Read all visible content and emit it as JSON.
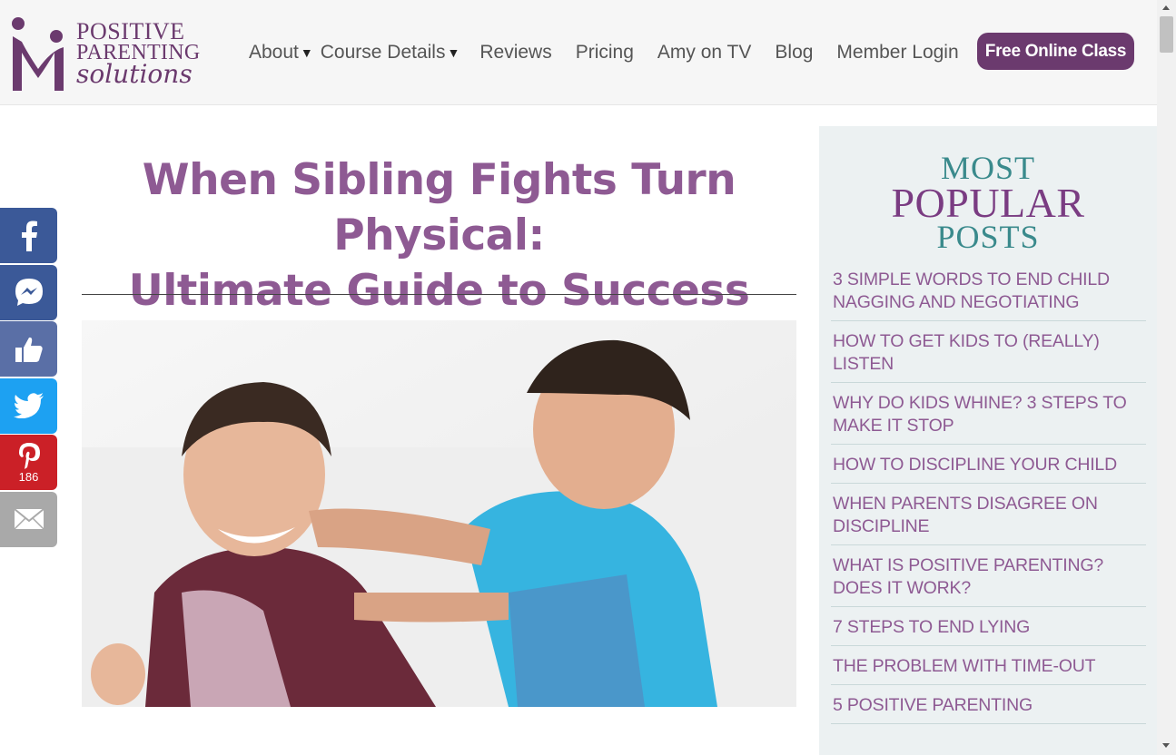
{
  "brand": {
    "line1": "POSITIVE",
    "line2": "PARENTING",
    "line3": "solutions",
    "color": "#6b3a6e"
  },
  "nav": {
    "items": [
      {
        "label": "About",
        "has_dropdown": true
      },
      {
        "label": "Course Details",
        "has_dropdown": true
      },
      {
        "label": "Reviews",
        "has_dropdown": false
      },
      {
        "label": "Pricing",
        "has_dropdown": false
      },
      {
        "label": "Amy on TV",
        "has_dropdown": false
      },
      {
        "label": "Blog",
        "has_dropdown": false
      },
      {
        "label": "Member Login",
        "has_dropdown": false
      }
    ],
    "caret": "▾",
    "cta_label": "Free Online Class"
  },
  "article": {
    "title_line1": "When Sibling Fights Turn Physical:",
    "title_line2": "Ultimate Guide to Success",
    "hero_alt": "Two boys play-fighting",
    "title_color": "#8e5a93"
  },
  "share": {
    "buttons": [
      {
        "name": "facebook",
        "icon": "facebook-icon",
        "color": "#3b5998",
        "count": ""
      },
      {
        "name": "messenger",
        "icon": "messenger-icon",
        "color": "#3b5998",
        "count": ""
      },
      {
        "name": "like",
        "icon": "thumbs-up-icon",
        "color": "#5a6fa6",
        "count": ""
      },
      {
        "name": "twitter",
        "icon": "twitter-icon",
        "color": "#1da1f2",
        "count": ""
      },
      {
        "name": "pinterest",
        "icon": "pinterest-icon",
        "color": "#cb2027",
        "count": "186"
      },
      {
        "name": "email",
        "icon": "email-icon",
        "color": "#a9a9a9",
        "count": ""
      }
    ]
  },
  "sidebar": {
    "heading_line1": "MOST",
    "heading_line2": "POPULAR",
    "heading_line3": "POSTS",
    "posts": [
      "3 SIMPLE WORDS TO END CHILD NAGGING AND NEGOTIATING",
      "HOW TO GET KIDS TO (REALLY) LISTEN",
      "WHY DO KIDS WHINE? 3 STEPS TO MAKE IT STOP",
      "HOW TO DISCIPLINE YOUR CHILD",
      "WHEN PARENTS DISAGREE ON DISCIPLINE",
      "WHAT IS POSITIVE PARENTING? DOES IT WORK?",
      "7 STEPS TO END LYING",
      "THE PROBLEM WITH TIME-OUT",
      "5 POSITIVE PARENTING"
    ]
  }
}
